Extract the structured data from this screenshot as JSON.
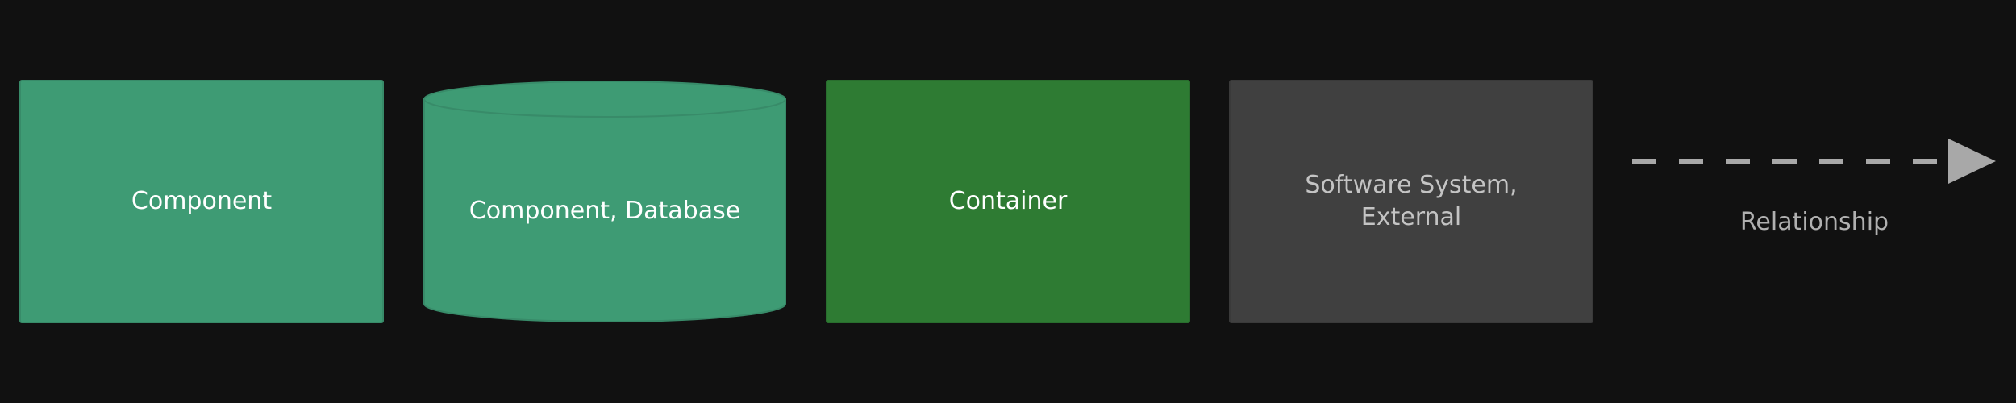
{
  "legend": {
    "items": [
      {
        "label": "Component",
        "shape": "box",
        "fill": "#3e9b74",
        "text_color": "#ffffff"
      },
      {
        "label": "Component, Database",
        "shape": "cylinder",
        "fill": "#3e9b74",
        "text_color": "#ffffff"
      },
      {
        "label": "Container",
        "shape": "box",
        "fill": "#2e7b33",
        "text_color": "#ffffff"
      },
      {
        "label": "Software System, External",
        "shape": "box",
        "fill": "#404040",
        "text_color": "#c4c4c4"
      }
    ],
    "relationship": {
      "label": "Relationship",
      "style": "dashed",
      "color": "#a8a8a8"
    },
    "background": "#111111"
  }
}
